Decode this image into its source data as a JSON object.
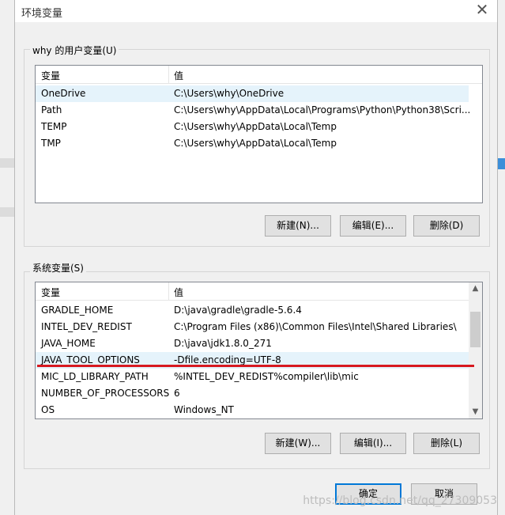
{
  "window": {
    "title": "环境变量",
    "close_glyph": "✕"
  },
  "user_section": {
    "label": "why 的用户变量(U)",
    "columns": [
      "变量",
      "值"
    ],
    "rows": [
      {
        "name": "OneDrive",
        "value": "C:\\Users\\why\\OneDrive"
      },
      {
        "name": "Path",
        "value": "C:\\Users\\why\\AppData\\Local\\Programs\\Python\\Python38\\Scri..."
      },
      {
        "name": "TEMP",
        "value": "C:\\Users\\why\\AppData\\Local\\Temp"
      },
      {
        "name": "TMP",
        "value": "C:\\Users\\why\\AppData\\Local\\Temp"
      }
    ],
    "buttons": {
      "new": "新建(N)...",
      "edit": "编辑(E)...",
      "delete": "删除(D)"
    }
  },
  "system_section": {
    "label": "系统变量(S)",
    "columns": [
      "变量",
      "值"
    ],
    "rows": [
      {
        "name": "GRADLE_HOME",
        "value": "D:\\java\\gradle\\gradle-5.6.4"
      },
      {
        "name": "INTEL_DEV_REDIST",
        "value": "C:\\Program Files (x86)\\Common Files\\Intel\\Shared Libraries\\"
      },
      {
        "name": "JAVA_HOME",
        "value": "D:\\java\\jdk1.8.0_271"
      },
      {
        "name": "JAVA_TOOL_OPTIONS",
        "value": "-Dfile.encoding=UTF-8"
      },
      {
        "name": "MIC_LD_LIBRARY_PATH",
        "value": "%INTEL_DEV_REDIST%compiler\\lib\\mic"
      },
      {
        "name": "NUMBER_OF_PROCESSORS",
        "value": "6"
      },
      {
        "name": "OS",
        "value": "Windows_NT"
      }
    ],
    "buttons": {
      "new": "新建(W)...",
      "edit": "编辑(I)...",
      "delete": "删除(L)"
    }
  },
  "footer": {
    "ok": "确定",
    "cancel": "取消"
  },
  "watermark": "https://blog.csdn.net/qq_27309053",
  "colors": {
    "highlight_line": "#d71920",
    "selection": "#e5f3fb",
    "primary_border": "#0078d7"
  }
}
